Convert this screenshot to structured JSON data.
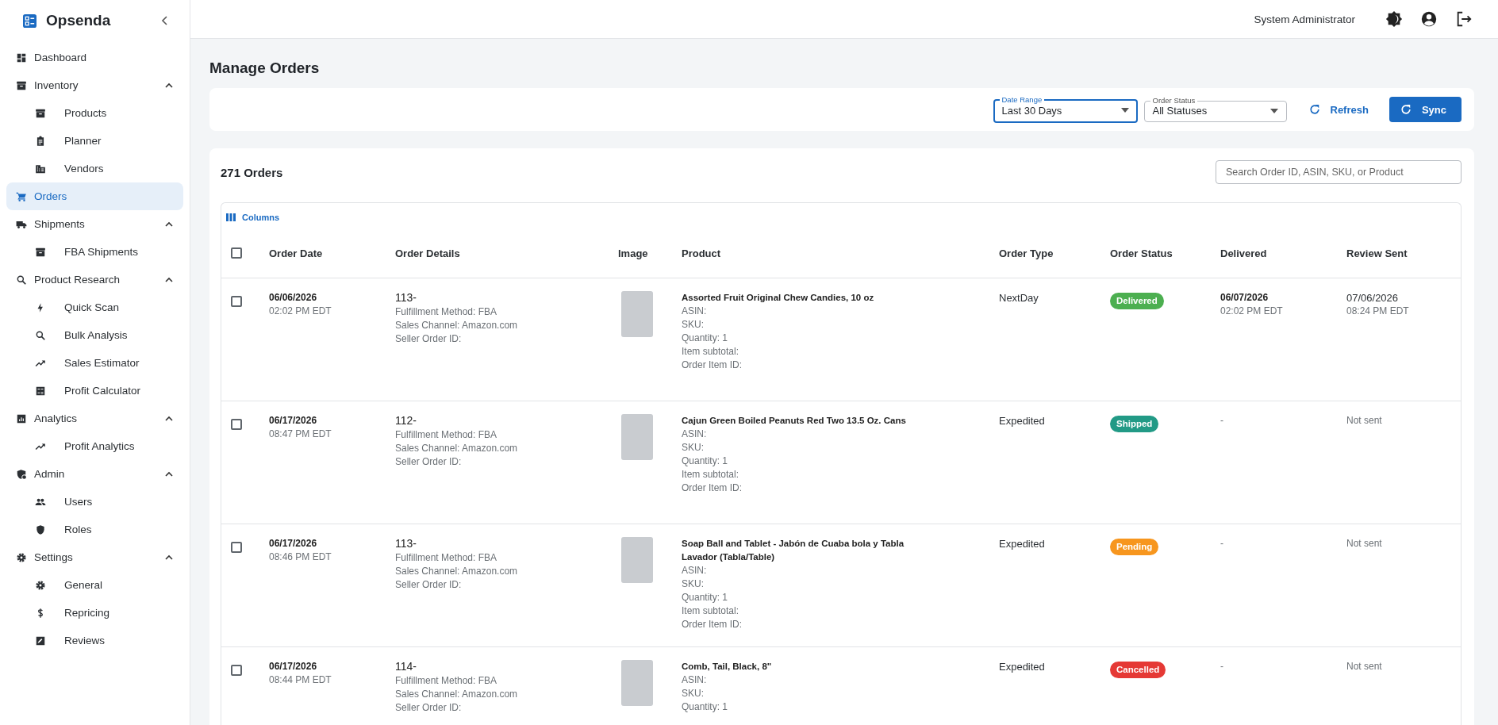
{
  "app": {
    "name": "Opsenda"
  },
  "sidebar": {
    "items": [
      {
        "label": "Dashboard",
        "selected": false
      },
      {
        "label": "Inventory",
        "selected": false,
        "expanded": true,
        "children": [
          {
            "label": "Products",
            "selected": false
          },
          {
            "label": "Planner",
            "selected": false
          },
          {
            "label": "Vendors",
            "selected": false
          }
        ]
      },
      {
        "label": "Orders",
        "selected": true
      },
      {
        "label": "Shipments",
        "selected": false,
        "expanded": true,
        "children": [
          {
            "label": "FBA Shipments",
            "selected": false
          }
        ]
      },
      {
        "label": "Product Research",
        "selected": false,
        "expanded": true,
        "children": [
          {
            "label": "Quick Scan",
            "selected": false
          },
          {
            "label": "Bulk Analysis",
            "selected": false
          },
          {
            "label": "Sales Estimator",
            "selected": false
          },
          {
            "label": "Profit Calculator",
            "selected": false
          }
        ]
      },
      {
        "label": "Analytics",
        "selected": false,
        "expanded": true,
        "children": [
          {
            "label": "Profit Analytics",
            "selected": false
          }
        ]
      },
      {
        "label": "Admin",
        "selected": false,
        "expanded": true,
        "children": [
          {
            "label": "Users",
            "selected": false
          },
          {
            "label": "Roles",
            "selected": false
          }
        ]
      },
      {
        "label": "Settings",
        "selected": false,
        "expanded": true,
        "children": [
          {
            "label": "General",
            "selected": false
          },
          {
            "label": "Repricing",
            "selected": false
          },
          {
            "label": "Reviews",
            "selected": false
          }
        ]
      }
    ]
  },
  "top_bar": {
    "user": "System Administrator"
  },
  "page": {
    "title": "Manage Orders"
  },
  "filters": [
    {
      "label": "Date Range",
      "value": "Last 30 Days",
      "focused": true
    },
    {
      "label": "Order Status",
      "value": "All Statuses",
      "focused": false
    }
  ],
  "actions": {
    "refresh": "Refresh",
    "sync": "Sync"
  },
  "orders": {
    "count": "271 Orders",
    "search": {
      "placeholder": "Search Order ID, ASIN, SKU, or Product"
    },
    "columns_button": "Columns",
    "table": {
      "select_all": {
        "checked": false
      },
      "columns": [
        "Order Date",
        "Order Details",
        "Image",
        "Product",
        "Order Type",
        "Order Status",
        "Delivered",
        "Review Sent"
      ],
      "rows": [
        {
          "checked": false,
          "date": "06/06/2026",
          "time": "02:02 PM EDT",
          "order_id": "113-",
          "order_lines": [
            "Fulfillment Method: FBA",
            "Sales Channel: Amazon.com",
            "Seller Order ID:"
          ],
          "product": "Assorted Fruit Original Chew Candies, 10 oz",
          "product_lines": [
            "ASIN:",
            "SKU:",
            "Quantity: 1",
            "Item subtotal:",
            "Order Item ID:"
          ],
          "order_type": "NextDay",
          "status": {
            "label": "Delivered",
            "color": "#4caf50"
          },
          "delivered": {
            "kind": "date",
            "date": "06/07/2026",
            "time": "02:02 PM EDT"
          },
          "review": {
            "kind": "date",
            "date": "07/06/2026",
            "time": "08:24 PM EDT"
          }
        },
        {
          "checked": false,
          "date": "06/17/2026",
          "time": "08:47 PM EDT",
          "order_id": "112-",
          "order_lines": [
            "Fulfillment Method: FBA",
            "Sales Channel: Amazon.com",
            "Seller Order ID:"
          ],
          "product": "Cajun Green Boiled Peanuts Red Two 13.5 Oz. Cans",
          "product_lines": [
            "ASIN:",
            "SKU:",
            "Quantity: 1",
            "Item subtotal:",
            "Order Item ID:"
          ],
          "order_type": "Expedited",
          "status": {
            "label": "Shipped",
            "color": "#229a86"
          },
          "delivered": {
            "kind": "none",
            "text": "-"
          },
          "review": {
            "kind": "none",
            "text": "Not sent"
          }
        },
        {
          "checked": false,
          "date": "06/17/2026",
          "time": "08:46 PM EDT",
          "order_id": "113-",
          "order_lines": [
            "Fulfillment Method: FBA",
            "Sales Channel: Amazon.com",
            "Seller Order ID:"
          ],
          "product": "Soap Ball and Tablet - Jabón de Cuaba bola y Tabla Lavador (Tabla/Table)",
          "product_lines": [
            "ASIN:",
            "SKU:",
            "Quantity: 1",
            "Item subtotal:",
            "Order Item ID:"
          ],
          "order_type": "Expedited",
          "status": {
            "label": "Pending",
            "color": "#f7961e"
          },
          "delivered": {
            "kind": "none",
            "text": "-"
          },
          "review": {
            "kind": "none",
            "text": "Not sent"
          }
        },
        {
          "checked": false,
          "date": "06/17/2026",
          "time": "08:44 PM EDT",
          "order_id": "114-",
          "order_lines": [
            "Fulfillment Method: FBA",
            "Sales Channel: Amazon.com",
            "Seller Order ID:"
          ],
          "product": "Comb, Tail, Black, 8\"",
          "product_lines": [
            "ASIN:",
            "SKU:",
            "Quantity: 1"
          ],
          "order_type": "Expedited",
          "status": {
            "label": "Cancelled",
            "color": "#e53935"
          },
          "delivered": {
            "kind": "none",
            "text": "-"
          },
          "review": {
            "kind": "none",
            "text": "Not sent"
          }
        }
      ]
    }
  }
}
